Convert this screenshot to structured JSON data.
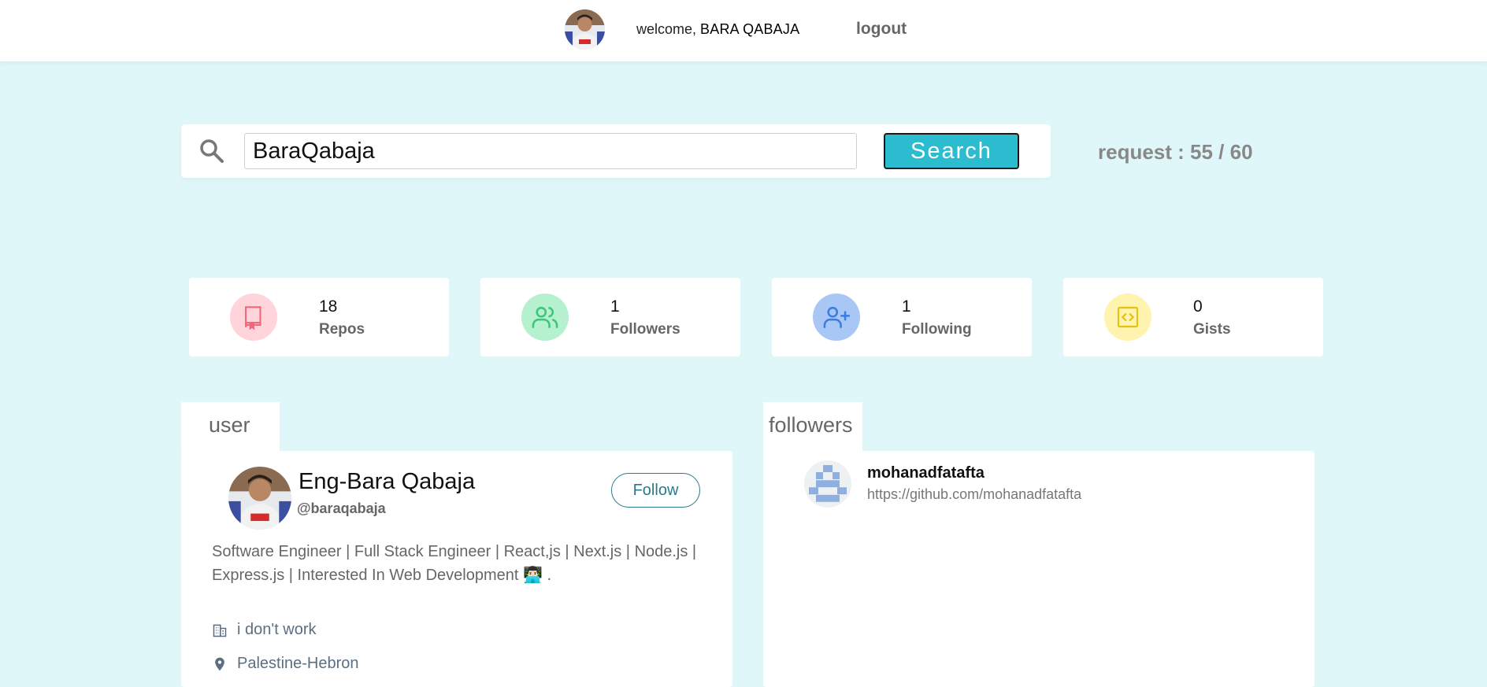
{
  "header": {
    "welcome_prefix": "welcome,",
    "user_name": "BARA QABAJA",
    "logout_label": "logout",
    "avatar_icon": "user-avatar"
  },
  "search": {
    "icon": "search-icon",
    "value": "BaraQabaja",
    "button_label": "Search",
    "request_text": "request : 55 / 60"
  },
  "stats": [
    {
      "value": "18",
      "label": "Repos",
      "icon": "book-icon",
      "bg": "#ffd4da",
      "color": "#f2667a"
    },
    {
      "value": "1",
      "label": "Followers",
      "icon": "users-icon",
      "bg": "#b5f0cf",
      "color": "#3cc47a"
    },
    {
      "value": "1",
      "label": "Following",
      "icon": "user-plus-icon",
      "bg": "#a9c7f5",
      "color": "#3a7ce0"
    },
    {
      "value": "0",
      "label": "Gists",
      "icon": "code-icon",
      "bg": "#fff3b0",
      "color": "#e2c20d"
    }
  ],
  "user_panel": {
    "tab_label": "user",
    "name": "Eng-Bara Qabaja",
    "handle": "@baraqabaja",
    "follow_label": "Follow",
    "bio": "Software Engineer | Full Stack Engineer | React,js | Next.js | Node.js | Express.js | Interested In Web Development 👨🏻‍💻 .",
    "company": "i don't work",
    "location": "Palestine-Hebron"
  },
  "followers_panel": {
    "tab_label": "followers",
    "items": [
      {
        "login": "mohanadfatafta",
        "url": "https://github.com/mohanadfatafta"
      }
    ]
  }
}
